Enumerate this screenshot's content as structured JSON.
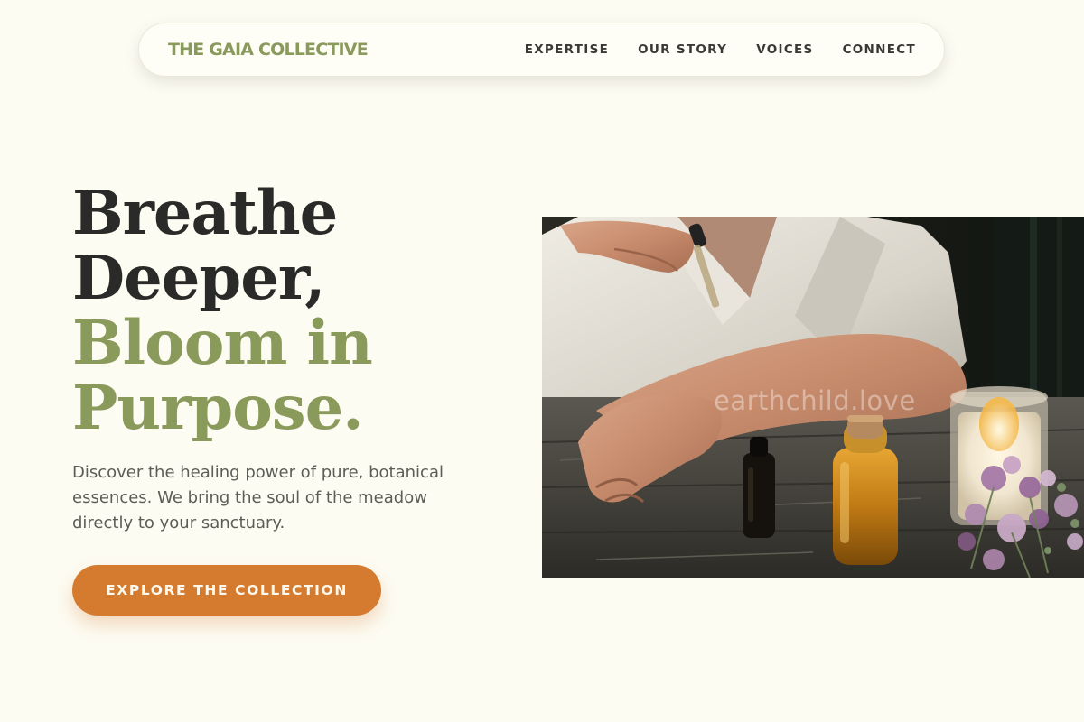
{
  "brand": {
    "name": "THE GAIA COLLECTIVE"
  },
  "nav": {
    "items": [
      {
        "label": "EXPERTISE"
      },
      {
        "label": "OUR STORY"
      },
      {
        "label": "VOICES"
      },
      {
        "label": "CONNECT"
      }
    ]
  },
  "hero": {
    "headline_line1": "Breathe",
    "headline_line2": "Deeper,",
    "headline_accent_line1": "Bloom in",
    "headline_accent_line2": "Purpose.",
    "description": "Discover the healing power of pure, botanical essences. We bring the soul of the meadow directly to your sanctuary.",
    "cta_label": "EXPLORE THE COLLECTION"
  },
  "photo": {
    "watermark": "earthchild.love"
  },
  "colors": {
    "background": "#fdfcf3",
    "brand_green": "#8a9a5b",
    "heading_dark": "#2a2a28",
    "cta_orange": "#d47b30"
  }
}
